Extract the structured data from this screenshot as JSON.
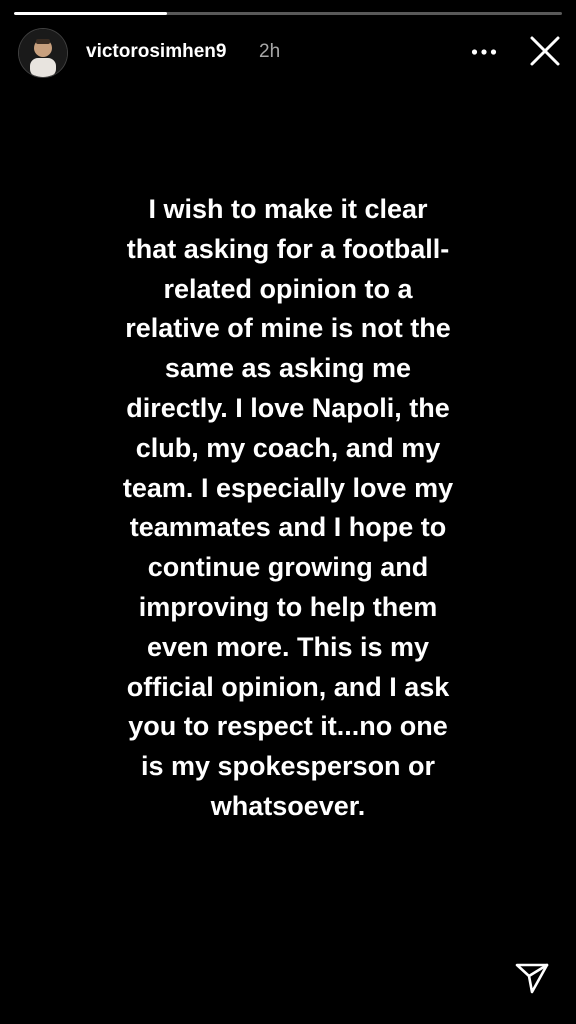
{
  "story": {
    "progress": 0.28,
    "username": "victorosimhen9",
    "timestamp": "2h",
    "text": "I wish to make it clear\nthat asking for a football-\nrelated opinion to a\nrelative of mine is not the\nsame as asking me\ndirectly. I love Napoli, the\nclub, my coach, and my\nteam. I especially love my\nteammates and I hope to\ncontinue growing and\nimproving to help them\neven more. This is my\nofficial opinion, and I ask\nyou to respect it...no one\nis my spokesperson or\nwhatsoever."
  },
  "icons": {
    "more": "more-horizontal-icon",
    "close": "close-icon",
    "share": "send-icon"
  },
  "colors": {
    "background": "#000000",
    "text": "#ffffff",
    "timestamp": "#a6a6a6"
  }
}
